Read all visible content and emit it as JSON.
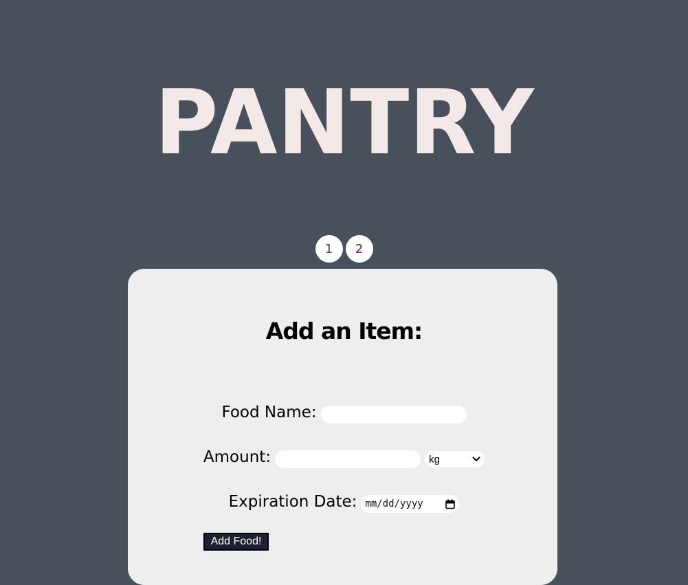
{
  "logo": {
    "text": "PANTRY"
  },
  "pager": {
    "pages": [
      "1",
      "2"
    ]
  },
  "form": {
    "title": "Add an Item:",
    "food_name_label": "Food Name:",
    "food_name_value": "",
    "amount_label": "Amount:",
    "amount_value": "",
    "unit_selected": "kg",
    "expiration_label": "Expiration Date:",
    "date_placeholder": "mm/dd/yyyy",
    "submit_label": "Add Food!"
  },
  "colors": {
    "background": "#48505c",
    "logo": "#f3e9e6",
    "card": "#eeeeee",
    "button": "#1f1f33",
    "page_link": "#551a8b"
  },
  "icons": {
    "select_arrow": "chevron-down-icon",
    "calendar": "calendar-icon"
  }
}
